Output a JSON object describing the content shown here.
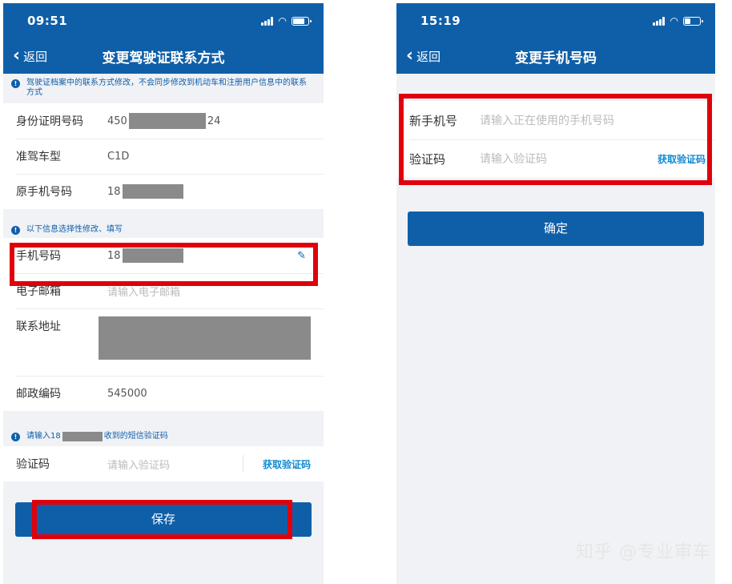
{
  "left": {
    "status_time": "09:51",
    "back_label": "返回",
    "title": "变更驾驶证联系方式",
    "notice_top": "驾驶证档案中的联系方式修改，不会同步修改到机动车和注册用户信息中的联系方式",
    "info_rows": [
      {
        "label": "身份证明号码",
        "prefix": "450",
        "suffix": "24"
      },
      {
        "label": "准驾车型",
        "value": "C1D"
      },
      {
        "label": "原手机号码",
        "prefix": "18"
      }
    ],
    "notice_optional": "以下信息选择性修改、填写",
    "phone_label": "手机号码",
    "phone_prefix": "18",
    "email_label": "电子邮箱",
    "email_placeholder": "请输入电子邮箱",
    "address_label": "联系地址",
    "postcode_label": "邮政编码",
    "postcode_value": "545000",
    "sms_notice_prefix": "请输入18",
    "sms_notice_suffix": "收到的短信验证码",
    "code_label": "验证码",
    "code_placeholder": "请输入验证码",
    "get_code_label": "获取验证码",
    "save_label": "保存"
  },
  "right": {
    "status_time": "15:19",
    "back_label": "返回",
    "title": "变更手机号码",
    "new_phone_label": "新手机号",
    "new_phone_placeholder": "请输入正在使用的手机号码",
    "code_label": "验证码",
    "code_placeholder": "请输入验证码",
    "get_code_label": "获取验证码",
    "confirm_label": "确定"
  },
  "watermark": "知乎 @专业审车",
  "colors": {
    "brand": "#0f5fa8",
    "highlight": "#e0000b",
    "link": "#0f8ad3"
  }
}
